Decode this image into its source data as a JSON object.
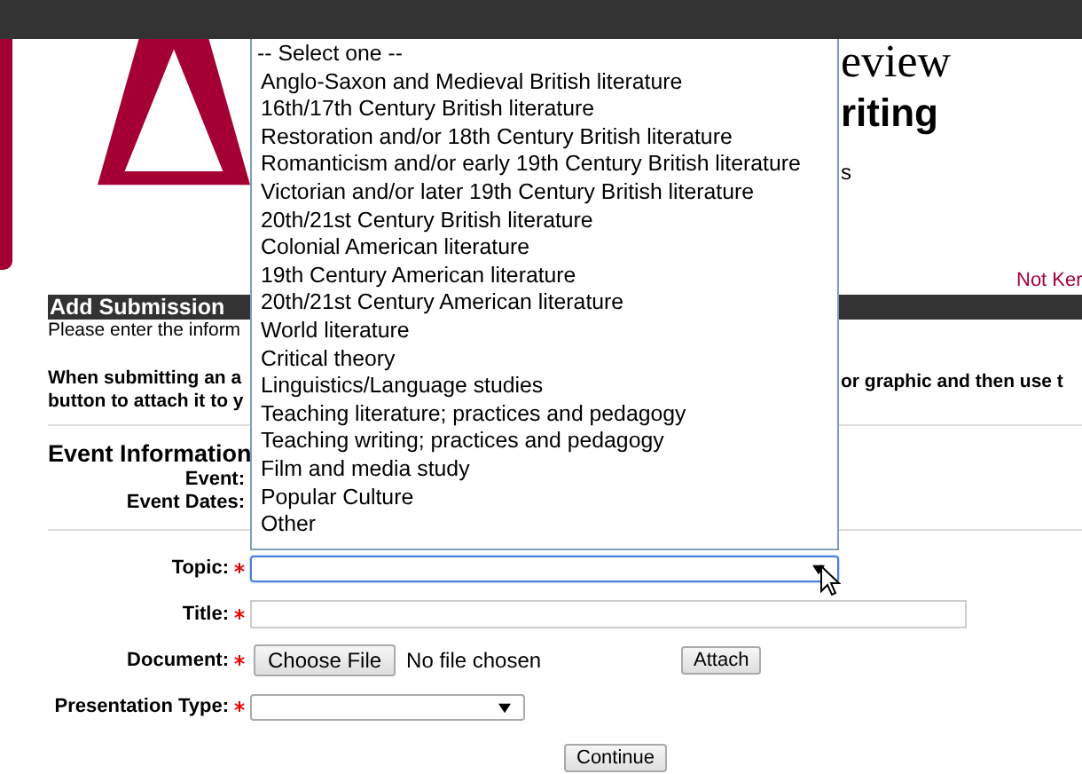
{
  "header": {
    "title_fragment": "eview",
    "subtitle_fragment": "riting",
    "tagline_fragment": "s",
    "user_link": "Not Ker"
  },
  "section": {
    "title": "Add Submission",
    "intro_fragment": "Please enter the inform",
    "note_left": [
      "When submitting an a",
      "button to attach it to y"
    ],
    "note_right": "or graphic and then use t"
  },
  "event": {
    "title": "Event Information",
    "labels": [
      "Event:",
      "Event Dates:"
    ]
  },
  "form": {
    "fields": [
      {
        "kind": "select",
        "label": "Topic:",
        "required": true,
        "focused": true,
        "wide": true
      },
      {
        "kind": "text",
        "label": "Title:",
        "required": true
      },
      {
        "kind": "file",
        "label": "Document:",
        "required": true,
        "button": "Choose File",
        "status": "No file chosen",
        "action": "Attach"
      },
      {
        "kind": "select",
        "label": "Presentation Type:",
        "required": true,
        "focused": false,
        "wide": false
      }
    ]
  },
  "topic_dropdown": {
    "expanded": true,
    "options": [
      {
        "label": "-- Select one --",
        "selected": false
      },
      {
        "label": "Anglo-Saxon and Medieval British literature",
        "selected": false
      },
      {
        "label": "16th/17th Century British literature",
        "selected": false
      },
      {
        "label": "Restoration and/or 18th Century British literature",
        "selected": false
      },
      {
        "label": "Romanticism and/or early 19th Century British literature",
        "selected": false
      },
      {
        "label": "Victorian and/or later 19th Century British literature",
        "selected": false
      },
      {
        "label": "20th/21st Century British literature",
        "selected": false
      },
      {
        "label": "Colonial American literature",
        "selected": false
      },
      {
        "label": "19th Century American literature",
        "selected": false
      },
      {
        "label": "20th/21st Century American literature",
        "selected": false
      },
      {
        "label": "World literature",
        "selected": false
      },
      {
        "label": "Critical theory",
        "selected": false
      },
      {
        "label": "Linguistics/Language studies",
        "selected": false
      },
      {
        "label": "Teaching literature; practices and pedagogy",
        "selected": false
      },
      {
        "label": "Teaching writing; practices and pedagogy",
        "selected": false
      },
      {
        "label": "Film and media study",
        "selected": false
      },
      {
        "label": "Popular Culture",
        "selected": false
      },
      {
        "label": "Other",
        "selected": false
      }
    ]
  },
  "buttons": [
    "Continue"
  ]
}
